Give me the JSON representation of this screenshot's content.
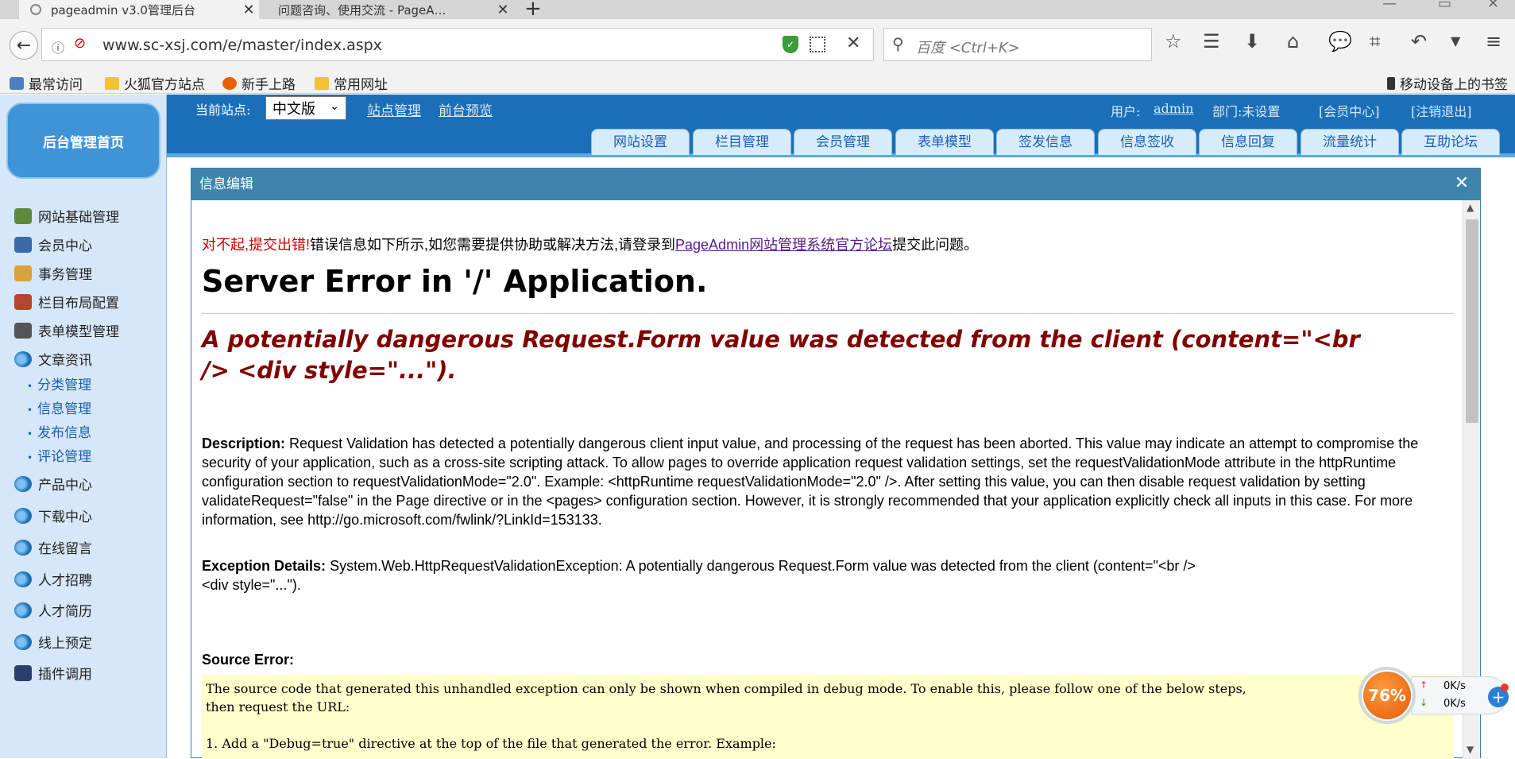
{
  "browser": {
    "tabs": [
      {
        "label": "pageadmin v3.0管理后台",
        "close": "✕"
      },
      {
        "label": "问题咨询、使用交流 - PageA…",
        "close": "✕"
      }
    ],
    "new_tab": "+",
    "url": "www.sc-xsj.com/e/master/index.aspx",
    "search_placeholder": "百度 <Ctrl+K>",
    "bookmarks": [
      {
        "label": "最常访问",
        "icon": "bookmark-icon"
      },
      {
        "label": "火狐官方站点",
        "icon": "folder-icon"
      },
      {
        "label": "新手上路",
        "icon": "firefox-icon"
      },
      {
        "label": "常用网址",
        "icon": "folder-icon"
      }
    ],
    "mobile_bookmarks": "移动设备上的书签"
  },
  "admin": {
    "home_button": "后台管理首页",
    "current_site_label": "当前站点:",
    "current_site_value": "中文版",
    "top_links": [
      "站点管理",
      "前台预览"
    ],
    "user_label": "用户:",
    "user_name": "admin",
    "dept": "部门:未设置",
    "member_center": "[会员中心]",
    "logout": "[注销退出]",
    "nav_tabs": [
      "网站设置",
      "栏目管理",
      "会员管理",
      "表单模型",
      "签发信息",
      "信息签收",
      "信息回复",
      "流量统计",
      "互助论坛"
    ],
    "sidebar": {
      "items": [
        "网站基础管理",
        "会员中心",
        "事务管理",
        "栏目布局配置",
        "表单模型管理",
        "文章资讯"
      ],
      "sub_items": [
        "分类管理",
        "信息管理",
        "发布信息",
        "评论管理"
      ],
      "more_items": [
        "产品中心",
        "下载中心",
        "在线留言",
        "人才招聘",
        "人才简历",
        "线上预定",
        "插件调用"
      ]
    }
  },
  "dialog": {
    "title": "信息编辑",
    "close": "✕",
    "error_red": "对不起,提交出错!",
    "error_text": "错误信息如下所示,如您需要提供协助或解决方法,请登录到",
    "error_link": "PageAdmin网站管理系统官方论坛",
    "error_tail": "提交此问题。",
    "heading": "Server Error in '/' Application.",
    "exception_title": "A potentially dangerous Request.Form value was detected from the client (content=\"<br /> <div style=\"...\").",
    "description_label": "Description:",
    "description": "Request Validation has detected a potentially dangerous client input value, and processing of the request has been aborted. This value may indicate an attempt to compromise the security of your application, such as a cross-site scripting attack. To allow pages to override application request validation settings, set the requestValidationMode attribute in the httpRuntime configuration section to requestValidationMode=\"2.0\". Example: <httpRuntime requestValidationMode=\"2.0\" />. After setting this value, you can then disable request validation by setting validateRequest=\"false\" in the Page directive or in the <pages> configuration section. However, it is strongly recommended that your application explicitly check all inputs in this case. For more information, see http://go.microsoft.com/fwlink/?LinkId=153133.",
    "exception_label": "Exception Details:",
    "exception_details_1": "System.Web.HttpRequestValidationException: A potentially dangerous Request.Form value was detected from the client (content=\"<br />",
    "exception_details_2": "<div style=\"...\").",
    "source_error_label": "Source Error:",
    "code": "The source code that generated this unhandled exception can only be shown when compiled in debug mode. To enable this, please follow one of the below steps,\nthen request the URL:\n\n1. Add a \"Debug=true\" directive at the top of the file that generated the error. Example:\n\n   <%@ Page Language=\"C#\" Debug=\"true\" %>"
  },
  "speed_widget": {
    "percent": "76%",
    "up": "0K/s",
    "down": "0K/s"
  },
  "colors": {
    "header_blue": "#1b6fb8",
    "dialog_title": "#3e84ad",
    "error_red": "#cc0000",
    "code_bg": "#ffffcc"
  }
}
